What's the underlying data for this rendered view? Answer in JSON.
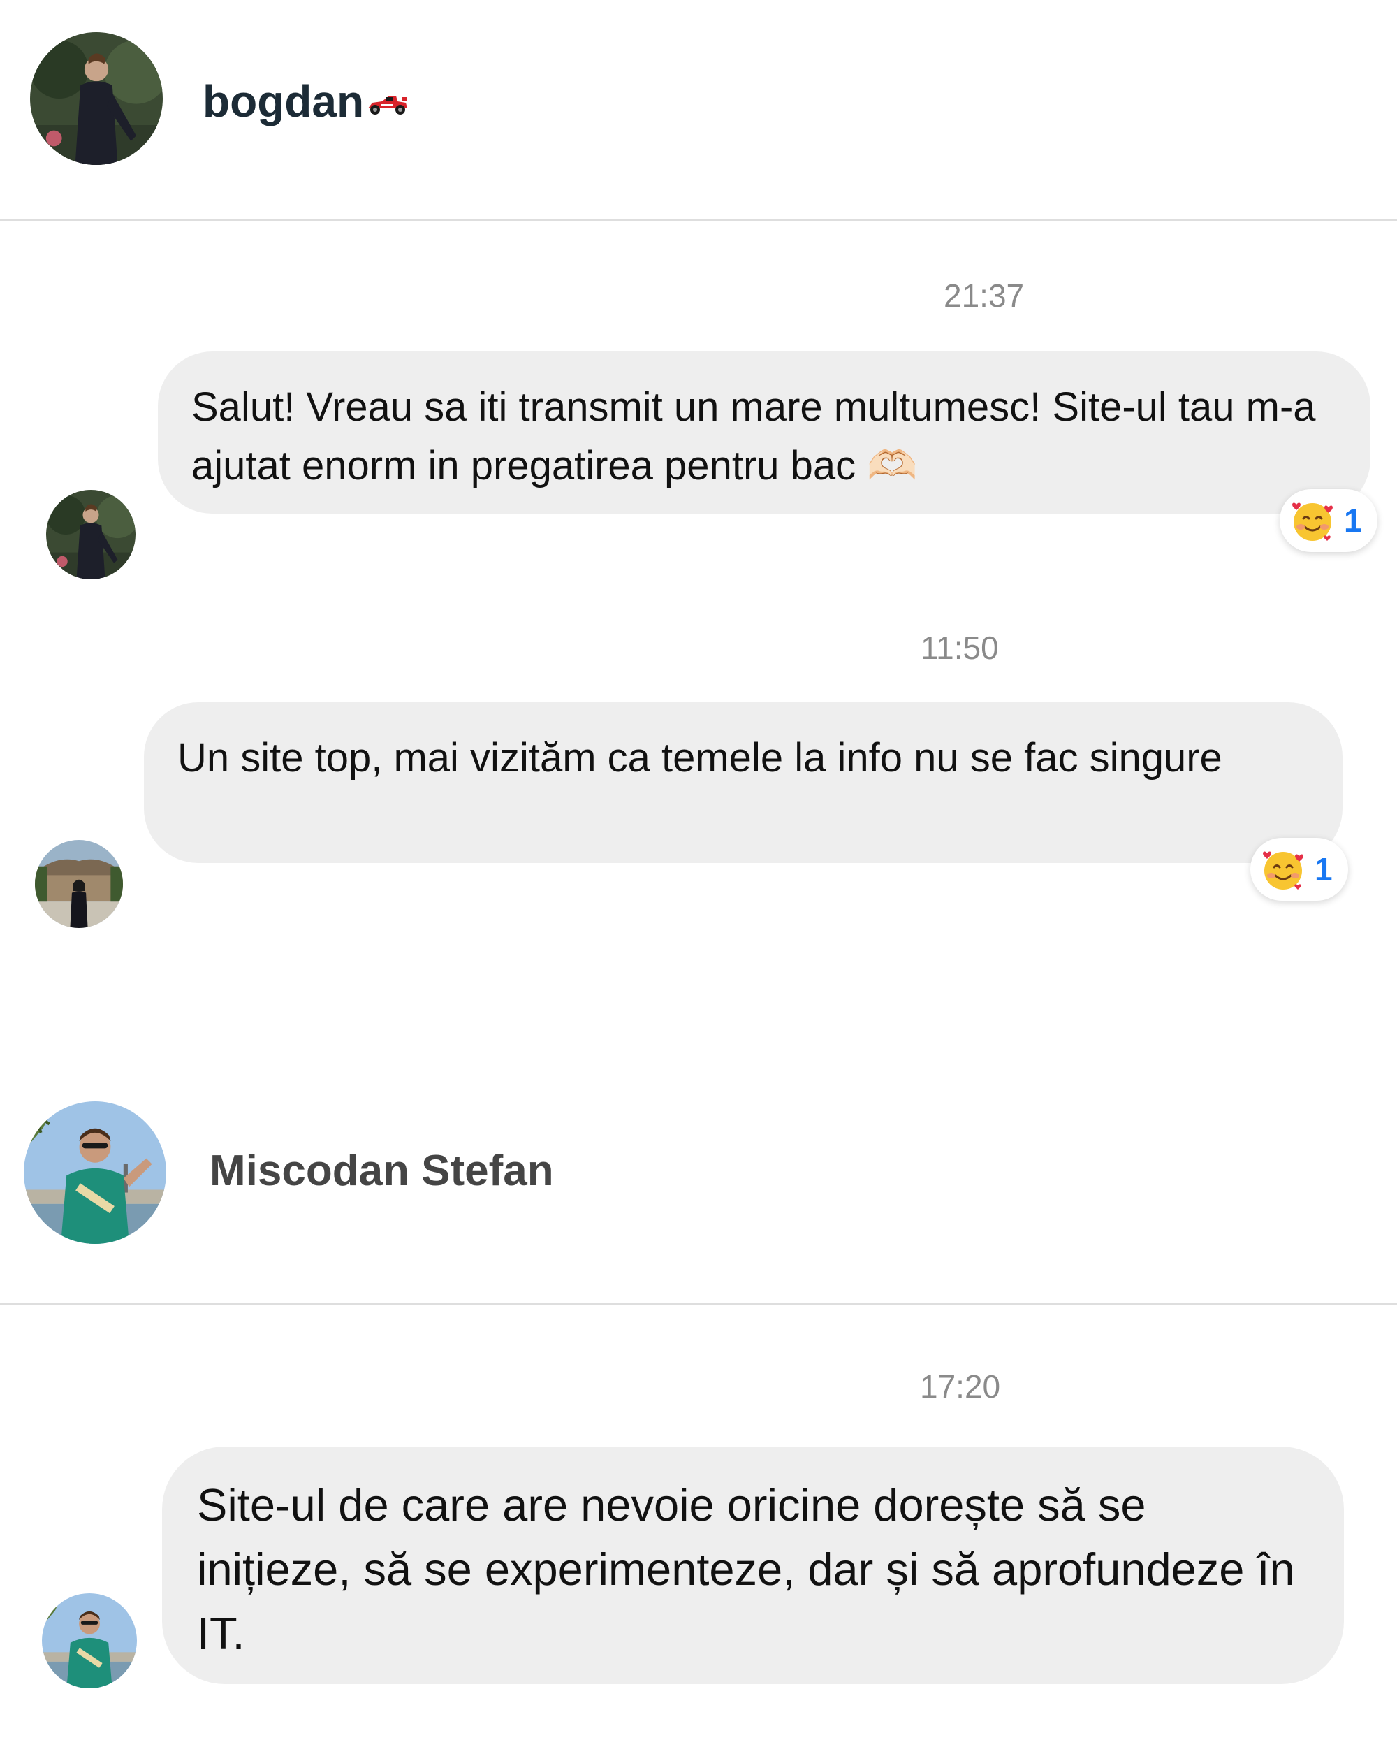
{
  "conversations": [
    {
      "header": {
        "name": "bogdan",
        "badge_icon": "race-car-icon",
        "avatar_icon": "profile-photo"
      },
      "messages": [
        {
          "time": "21:37",
          "text": "Salut! Vreau sa iti transmit un mare multumesc! Site-ul tau m-a ajutat enorm in pregatirea pentru bac 🫶🏻",
          "reaction": {
            "icon": "smiling-face-with-hearts-icon",
            "count": "1"
          }
        },
        {
          "time": "11:50",
          "text": "Un site top, mai vizităm ca temele la info nu se fac singure",
          "reaction": {
            "icon": "smiling-face-with-hearts-icon",
            "count": "1"
          }
        }
      ]
    },
    {
      "header": {
        "name": "Miscodan Stefan",
        "avatar_icon": "profile-photo"
      },
      "messages": [
        {
          "time": "17:20",
          "text": "Site-ul de care are nevoie oricine dorește să se inițieze, să se experimenteze, dar și să aprofundeze în IT."
        }
      ]
    }
  ]
}
